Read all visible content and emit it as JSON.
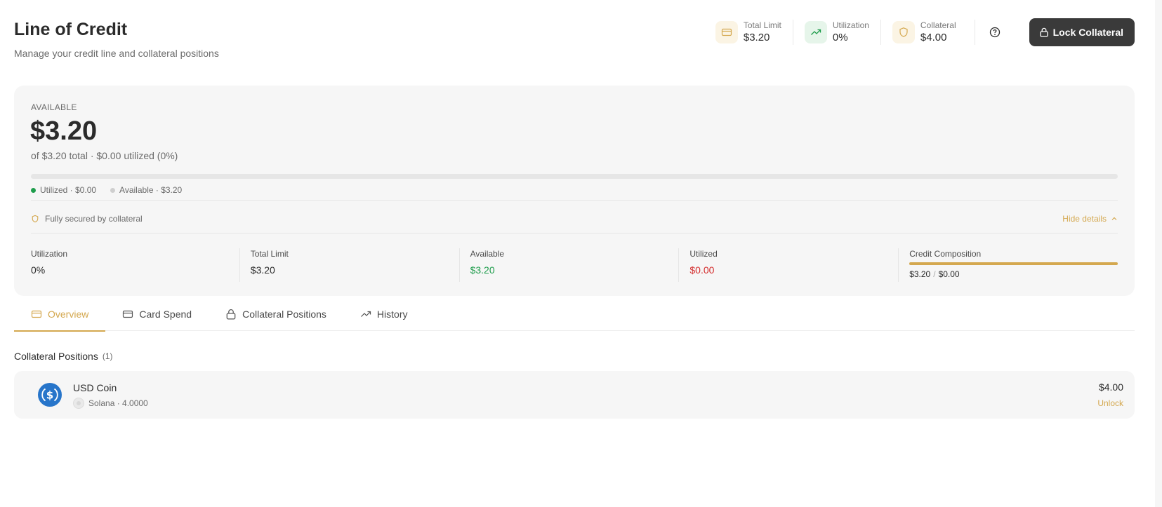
{
  "header": {
    "title": "Line of Credit",
    "subtitle": "Manage your credit line and collateral positions"
  },
  "stats": [
    {
      "label": "Total Limit",
      "value": "$3.20",
      "icon": "card-icon"
    },
    {
      "label": "Utilization",
      "value": "0%",
      "icon": "trending-up-icon"
    },
    {
      "label": "Collateral",
      "value": "$4.00",
      "icon": "shield-icon"
    }
  ],
  "actions": {
    "lock_collateral": "Lock Collateral"
  },
  "credit": {
    "available_label": "AVAILABLE",
    "available_amount": "$3.20",
    "summary": "of $3.20 total · $0.00 utilized (0%)",
    "utilized_fraction": 0,
    "legend_utilized": "Utilized · $0.00",
    "legend_available": "Available · $3.20",
    "secured_text": "Fully secured by collateral",
    "hide_details": "Hide details",
    "metrics": [
      {
        "label": "Utilization",
        "value": "0%"
      },
      {
        "label": "Total Limit",
        "value": "$3.20"
      },
      {
        "label": "Available",
        "value": "$3.20"
      },
      {
        "label": "Utilized",
        "value": "$0.00"
      }
    ],
    "composition": {
      "label": "Credit Composition",
      "left": "$3.20",
      "separator": "/",
      "right": "$0.00"
    }
  },
  "tabs": [
    {
      "label": "Overview",
      "icon": "card-icon",
      "active": true
    },
    {
      "label": "Card Spend",
      "icon": "card-icon"
    },
    {
      "label": "Collateral Positions",
      "icon": "lock-icon"
    },
    {
      "label": "History",
      "icon": "trending-up-icon"
    }
  ],
  "positions": {
    "title": "Collateral Positions",
    "count": "(1)",
    "items": [
      {
        "name": "USD Coin",
        "meta": "Solana · 4.0000",
        "value": "$4.00",
        "action": "Unlock"
      }
    ]
  },
  "colors": {
    "accent": "#d4a84f",
    "positive": "#1f9d4c",
    "negative": "#d42f2f",
    "usdc": "#2775ca"
  }
}
